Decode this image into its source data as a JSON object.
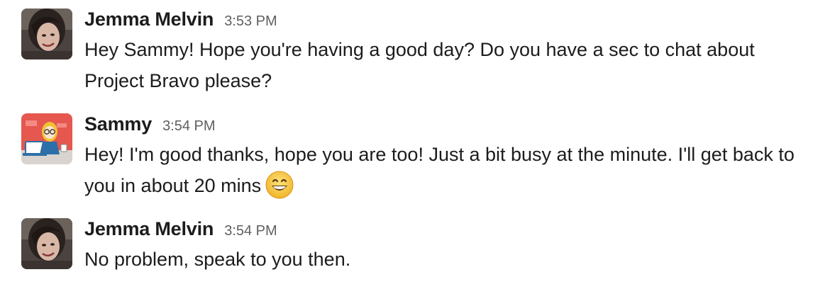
{
  "messages": [
    {
      "sender": "Jemma Melvin",
      "time": "3:53 PM",
      "text": "Hey Sammy! Hope you're having a good day? Do you have a sec to chat about Project Bravo please?",
      "avatar": "photo-avatar"
    },
    {
      "sender": "Sammy",
      "time": "3:54 PM",
      "text": "Hey! I'm good thanks, hope you are too! Just a bit busy at the minute. I'll get back to you in about 20 mins",
      "emoji": "grinning-smile-emoji",
      "avatar": "illustrated-avatar"
    },
    {
      "sender": "Jemma Melvin",
      "time": "3:54 PM",
      "text": "No problem, speak to you then.",
      "avatar": "photo-avatar"
    }
  ]
}
